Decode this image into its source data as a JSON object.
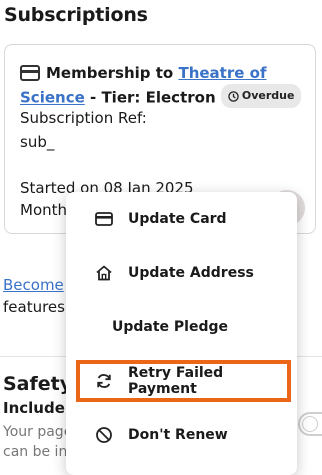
{
  "section": {
    "title": "Subscriptions"
  },
  "subscription": {
    "prefix": "Membership to",
    "org_link": "Theatre of Science",
    "tier": "- Tier: Electron",
    "status_badge": "Overdue",
    "ref_label": "Subscription Ref:",
    "ref_value": "sub_",
    "started_text": "Started on 08 Jan 2025",
    "billing_text": "Monthly"
  },
  "below": {
    "link_text": "Become",
    "text": "features,"
  },
  "safety": {
    "title": "Safety",
    "subtitle": "Include",
    "description": "Your page can be in"
  },
  "menu": {
    "items": [
      {
        "label": "Update Card",
        "icon": "credit-card-icon"
      },
      {
        "label": "Update Address",
        "icon": "home-icon"
      },
      {
        "label": "Update Pledge",
        "icon": ""
      },
      {
        "label": "Retry Failed Payment",
        "icon": "refresh-icon"
      },
      {
        "label": "Don't Renew",
        "icon": "block-icon"
      }
    ]
  },
  "colors": {
    "link": "#3a72c8",
    "highlight": "#ec6618",
    "badge_bg": "#e8e8e8",
    "more_button_bg": "#e2dcdc"
  }
}
